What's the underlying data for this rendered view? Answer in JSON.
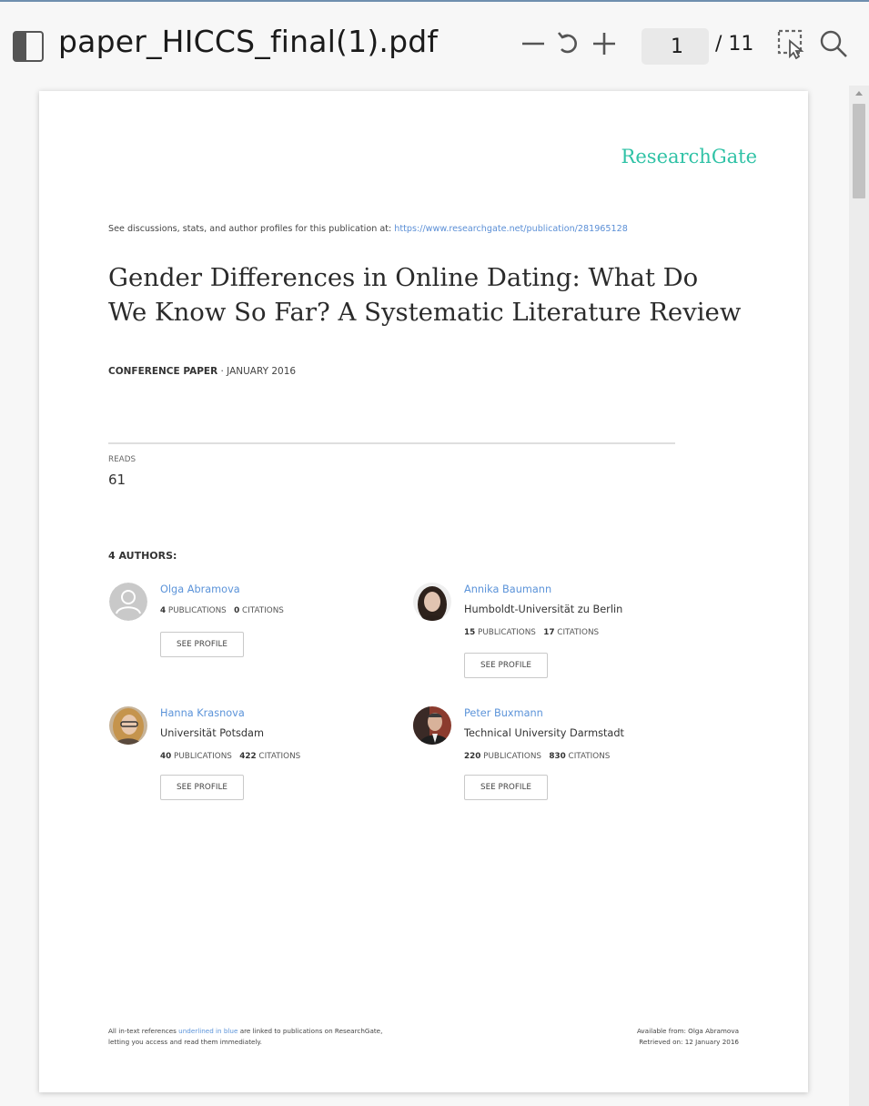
{
  "toolbar": {
    "title": "paper_HICCS_final(1).pdf",
    "page_current": "1",
    "page_total": "/ 11"
  },
  "icons": {
    "sidebar": "sidebar-toggle-icon",
    "zoom_out": "minus-icon",
    "rotate": "rotate-icon",
    "zoom_in": "plus-icon",
    "select": "selection-cursor-icon",
    "search": "search-icon"
  },
  "paper": {
    "logo": "ResearchGate",
    "discussion_prefix": "See discussions, stats, and author profiles for this publication at:",
    "discussion_url": "https://www.researchgate.net/publication/281965128",
    "title_line1": "Gender Differences in Online Dating: What Do",
    "title_line2": "We Know So Far? A Systematic Literature Review",
    "type_bold": "CONFERENCE PAPER",
    "type_rest": " · JANUARY 2016",
    "reads_label": "READS",
    "reads_value": "61",
    "authors_label": "4 AUTHORS:",
    "see_profile": "SEE PROFILE",
    "publications_label": "PUBLICATIONS",
    "citations_label": "CITATIONS",
    "authors": [
      {
        "name": "Olga Abramova",
        "institution": "",
        "publications": "4",
        "citations": "0"
      },
      {
        "name": "Annika Baumann",
        "institution": "Humboldt-Universität zu Berlin",
        "publications": "15",
        "citations": "17"
      },
      {
        "name": "Hanna Krasnova",
        "institution": "Universität Potsdam",
        "publications": "40",
        "citations": "422"
      },
      {
        "name": "Peter Buxmann",
        "institution": "Technical University Darmstadt",
        "publications": "220",
        "citations": "830"
      }
    ],
    "footer_left_1a": "All in-text references ",
    "footer_left_1b": "underlined in blue",
    "footer_left_1c": " are linked to publications on ResearchGate,",
    "footer_left_2": "letting you access and read them immediately.",
    "footer_right_1": "Available from: Olga Abramova",
    "footer_right_2": "Retrieved on: 12 January 2016"
  }
}
